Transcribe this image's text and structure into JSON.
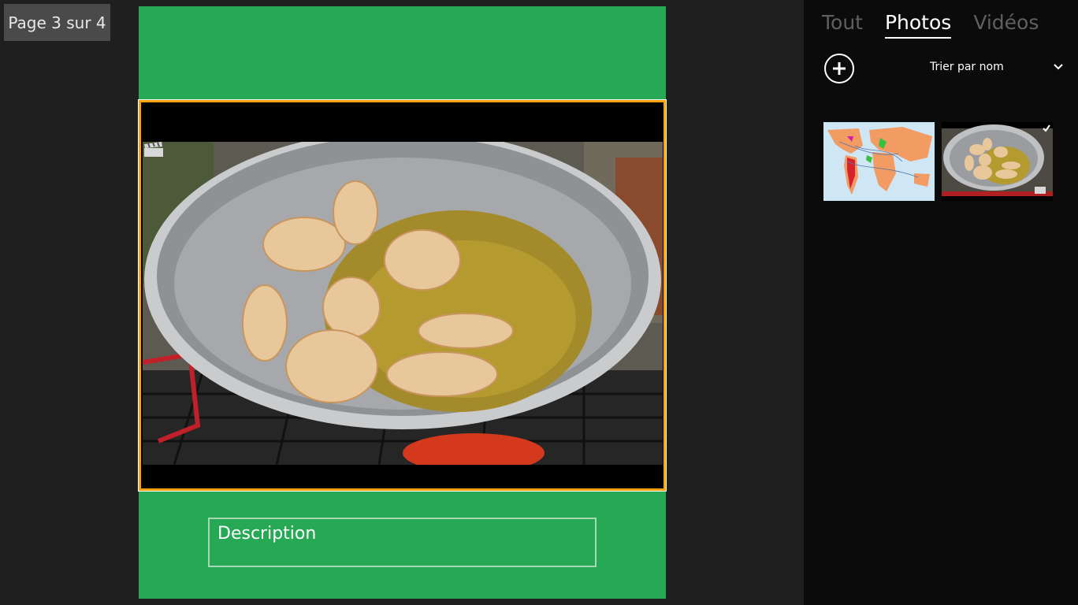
{
  "pager": {
    "label": "Page 3 sur 4"
  },
  "canvas": {
    "background": "#27a854",
    "selection_color": "#ffa20f",
    "description_placeholder": "Description"
  },
  "panel": {
    "tabs": [
      {
        "label": "Tout",
        "active": false
      },
      {
        "label": "Photos",
        "active": true
      },
      {
        "label": "Vidéos",
        "active": false
      }
    ],
    "add_icon": "plus-circle-icon",
    "sort_label": "Trier par nom",
    "sort_icon": "chevron-down-icon",
    "thumbnails": [
      {
        "kind": "image",
        "subject": "world-map"
      },
      {
        "kind": "video",
        "subject": "chicken-in-wok",
        "selected": true
      }
    ]
  }
}
